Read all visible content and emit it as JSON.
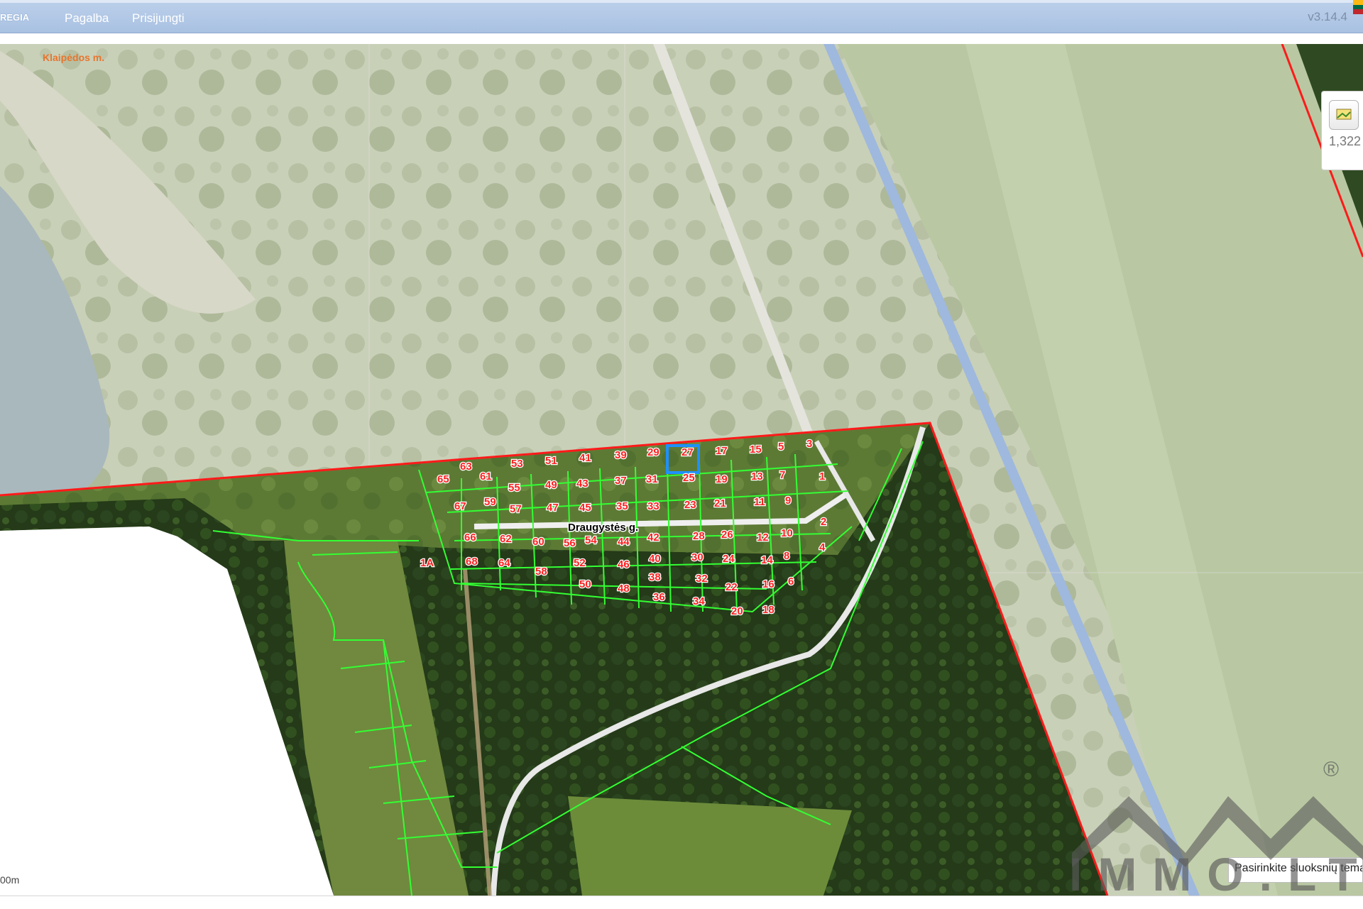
{
  "app": {
    "brand": "REGIA",
    "menu": [
      "Pagalba",
      "Prisijungti"
    ],
    "version": "v3.14.4"
  },
  "map": {
    "city_label": "Klaipėdos m.",
    "street_label": "Draugystės g.",
    "scale_label": "00m",
    "selected_plot": "27",
    "boundary_color": "#ff0000",
    "parcel_color": "#33ff33",
    "selection_color": "#1e90ff",
    "plots_row1": [
      "63",
      "53",
      "51",
      "41",
      "39",
      "29",
      "27",
      "17",
      "15",
      "5",
      "3"
    ],
    "plots_row2": [
      "65",
      "61",
      "55",
      "49",
      "43",
      "37",
      "31",
      "25",
      "19",
      "13",
      "7",
      "1"
    ],
    "plots_row3": [
      "67",
      "59",
      "57",
      "47",
      "45",
      "35",
      "33",
      "23",
      "21",
      "11",
      "9"
    ],
    "plots_row4": [
      "66",
      "62",
      "60",
      "56",
      "54",
      "44",
      "42",
      "28",
      "26",
      "12",
      "10",
      "2"
    ],
    "plots_row5": [
      "68",
      "64",
      "58",
      "52",
      "46",
      "40",
      "30",
      "24",
      "14",
      "8",
      "4"
    ],
    "plots_row6": [
      "50",
      "48",
      "38",
      "36",
      "32",
      "34",
      "22",
      "20",
      "16",
      "18",
      "6"
    ],
    "other_plot": "1A"
  },
  "tools": {
    "layer_tool_icon": "layers-icon",
    "measure_value": "1,322"
  },
  "layers": {
    "select_label": "Pasirinkite sluoksnių temą"
  },
  "watermark": {
    "text": "IMMO.LT",
    "registered": "®"
  }
}
